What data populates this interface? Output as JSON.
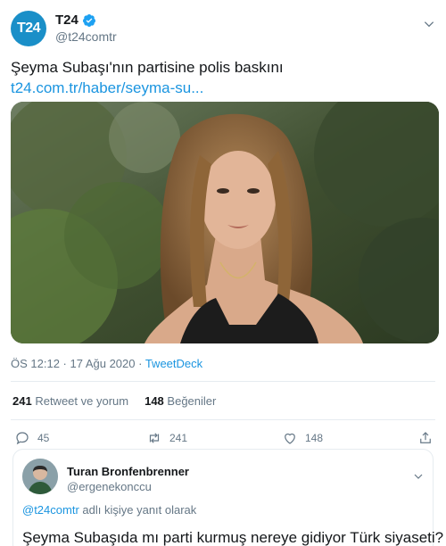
{
  "tweet": {
    "avatar_text": "T24",
    "display_name": "T24",
    "handle": "@t24comtr",
    "text": "Şeyma Subaşı'nın partisine polis baskını",
    "link": "t24.com.tr/haber/seyma-su...",
    "time": "ÖS 12:12 · 17 Ağu 2020 · ",
    "source": "TweetDeck"
  },
  "stats": {
    "retweets_count": "241",
    "retweets_label": "Retweet ve yorum",
    "likes_count": "148",
    "likes_label": "Beğeniler"
  },
  "actions": {
    "reply_count": "45",
    "retweet_count": "241",
    "like_count": "148"
  },
  "reply": {
    "display_name": "Turan Bronfenbrenner",
    "handle": "@ergenekonccu",
    "reply_to_mention": "@t24comtr",
    "reply_to_suffix": " adlı kişiye yanıt olarak",
    "text": "Şeyma Subaşıda mı parti kurmuş nereye gidiyor Türk siyaseti?"
  },
  "colors": {
    "accent": "#1b95e0",
    "avatar_bg": "#1a8fc8",
    "muted": "#657786",
    "border": "#e6ecf0"
  },
  "icons": [
    "verified-icon",
    "chevron-down-icon",
    "reply-icon",
    "retweet-icon",
    "like-icon",
    "share-icon"
  ]
}
